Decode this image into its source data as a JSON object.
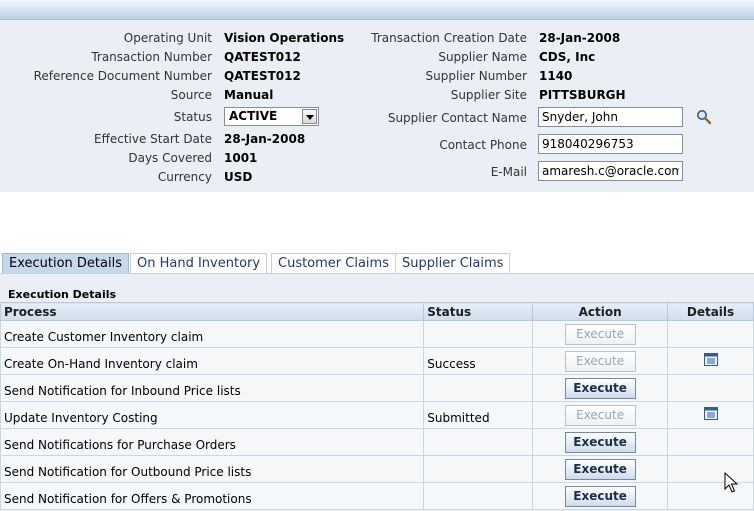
{
  "header": {
    "operating_unit_label": "Operating Unit",
    "operating_unit": "Vision Operations",
    "transaction_number_label": "Transaction Number",
    "transaction_number": "QATEST012",
    "reference_document_label": "Reference Document Number",
    "reference_document": "QATEST012",
    "source_label": "Source",
    "source": "Manual",
    "status_label": "Status",
    "status": "ACTIVE",
    "effective_start_label": "Effective Start Date",
    "effective_start": "28-Jan-2008",
    "days_covered_label": "Days Covered",
    "days_covered": "1001",
    "currency_label": "Currency",
    "currency": "USD",
    "creation_date_label": "Transaction Creation Date",
    "creation_date": "28-Jan-2008",
    "supplier_name_label": "Supplier Name",
    "supplier_name": "CDS, Inc",
    "supplier_number_label": "Supplier Number",
    "supplier_number": "1140",
    "supplier_site_label": "Supplier Site",
    "supplier_site": "PITTSBURGH",
    "contact_name_label": "Supplier Contact Name",
    "contact_name": "Snyder, John",
    "contact_phone_label": "Contact Phone",
    "contact_phone": "918040296753",
    "email_label": "E-Mail",
    "email": "amaresh.c@oracle.com"
  },
  "tabs": [
    "Execution Details",
    "On Hand Inventory",
    "Customer Claims",
    "Supplier Claims"
  ],
  "section_title": "Execution Details",
  "table": {
    "headers": [
      "Process",
      "Status",
      "Action",
      "Details"
    ],
    "action_label": "Execute",
    "rows": [
      {
        "process": "Create Customer Inventory claim",
        "status": "",
        "enabled": false,
        "details": false
      },
      {
        "process": "Create On-Hand Inventory claim",
        "status": "Success",
        "enabled": false,
        "details": true
      },
      {
        "process": "Send Notification for Inbound Price lists",
        "status": "",
        "enabled": true,
        "details": false
      },
      {
        "process": "Update Inventory Costing",
        "status": "Submitted",
        "enabled": false,
        "details": true
      },
      {
        "process": "Send Notifications for Purchase Orders",
        "status": "",
        "enabled": true,
        "details": false
      },
      {
        "process": "Send Notification for Outbound Price lists",
        "status": "",
        "enabled": true,
        "details": false
      },
      {
        "process": "Send Notification for Offers & Promotions",
        "status": "",
        "enabled": true,
        "details": false
      }
    ]
  },
  "icons": {
    "search": "search-icon",
    "details": "details-icon"
  }
}
